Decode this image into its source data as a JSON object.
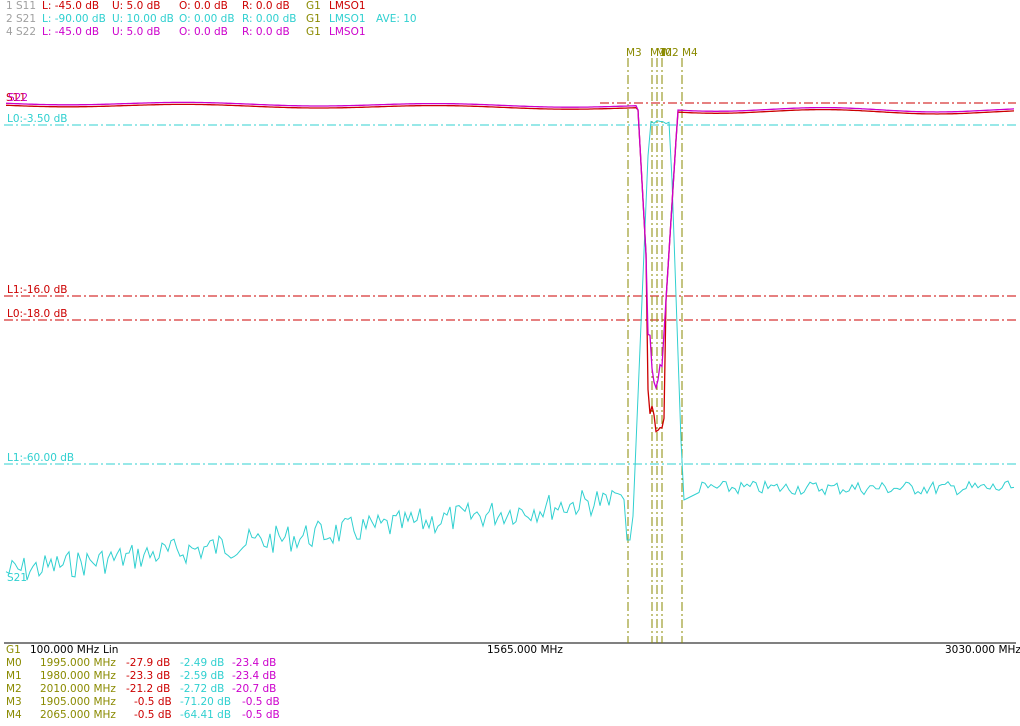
{
  "colors": {
    "gray": "#a0a0a0",
    "red": "#cc0000",
    "cyan": "#30d0d0",
    "magenta": "#cc00cc",
    "olive": "#8a8a00",
    "s11": "#cc0000",
    "s21": "#30d0d0",
    "s22": "#cc00cc",
    "s21_limit": "#30d0d0",
    "s11_limit": "#cc0000",
    "marker": "#8a8a00",
    "black": "#000000"
  },
  "header": {
    "rows": [
      {
        "id": "1 S11",
        "L": "L: -45.0 dB",
        "U": "U:  5.0 dB",
        "O": "O:  0.0 dB",
        "R": "R:  0.0 dB",
        "G": "G1",
        "src": "LMSO1",
        "extra": ""
      },
      {
        "id": "2 S21",
        "L": "L: -90.00 dB",
        "U": "U: 10.00 dB",
        "O": "O:  0.00 dB",
        "R": "R:  0.00 dB",
        "G": "G1",
        "src": "LMSO1",
        "extra": "AVE: 10"
      },
      {
        "id": "4 S22",
        "L": "L: -45.0 dB",
        "U": "U:  5.0 dB",
        "O": "O:  0.0 dB",
        "R": "R:  0.0 dB",
        "G": "G1",
        "src": "LMSO1",
        "extra": ""
      }
    ]
  },
  "trace_labels": {
    "s11_left": "S11",
    "s22_left": "S22",
    "s21_left": "S21"
  },
  "limits": [
    {
      "label": "L0:-3.50 dB",
      "color": "cyan"
    },
    {
      "label": "L1:-16.0 dB",
      "color": "red"
    },
    {
      "label": "L0:-18.0 dB",
      "color": "red"
    },
    {
      "label": "L1:-60.00 dB",
      "color": "cyan"
    }
  ],
  "axis": {
    "start": "100.000 MHz",
    "center": "1565.000 MHz",
    "stop": "3030.000 MHz",
    "group": "G1",
    "scale": "Lin"
  },
  "markers": [
    {
      "name": "M0",
      "freq": "1995.000 MHz",
      "s11": "-27.9 dB",
      "s21": "-2.49 dB",
      "s22": "-23.4 dB"
    },
    {
      "name": "M1",
      "freq": "1980.000 MHz",
      "s11": "-23.3 dB",
      "s21": "-2.59 dB",
      "s22": "-23.4 dB"
    },
    {
      "name": "M2",
      "freq": "2010.000 MHz",
      "s11": "-21.2 dB",
      "s21": "-2.72 dB",
      "s22": "-20.7 dB"
    },
    {
      "name": "M3",
      "freq": "1905.000 MHz",
      "s11": "-0.5 dB",
      "s21": "-71.20 dB",
      "s22": "-0.5 dB"
    },
    {
      "name": "M4",
      "freq": "2065.000 MHz",
      "s11": "-0.5 dB",
      "s21": "-64.41 dB",
      "s22": "-0.5 dB"
    }
  ],
  "marker_top_labels": {
    "m3": "M3",
    "m0": "M0",
    "m1": "M1",
    "m2": "M2",
    "m4": "M4"
  }
}
